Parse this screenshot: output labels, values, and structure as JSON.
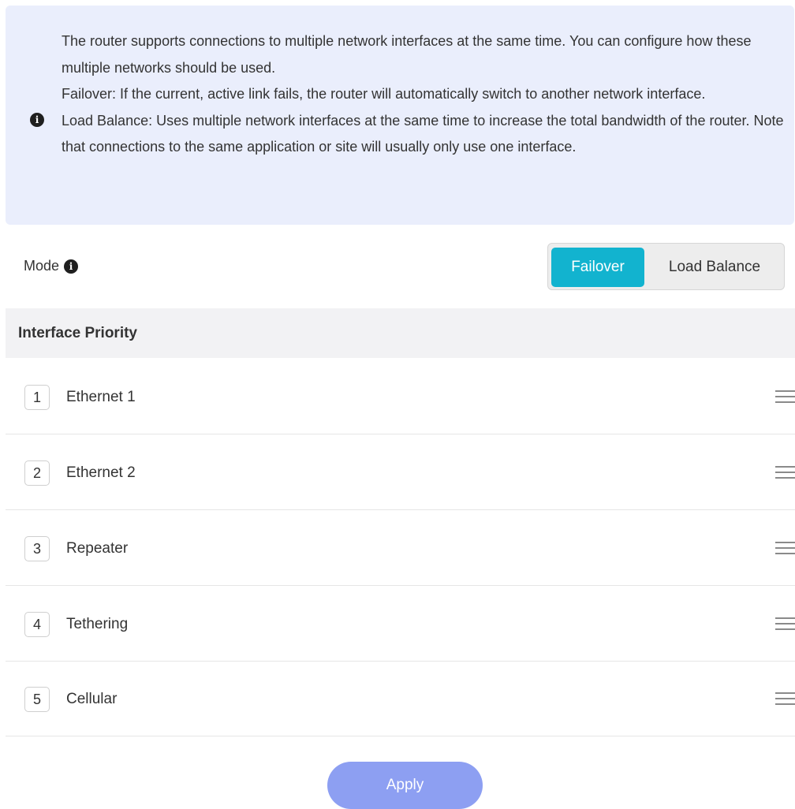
{
  "info": {
    "icon": "info-icon",
    "lines": [
      "The router supports connections to multiple network interfaces at the same time. You can configure how these multiple networks should be used.",
      "Failover: If the current, active link fails, the router will automatically switch to another network interface.",
      "Load Balance: Uses multiple network interfaces at the same time to increase the total bandwidth of the router. Note that connections to the same application or site will usually only use one interface."
    ]
  },
  "mode": {
    "label": "Mode",
    "options": [
      "Failover",
      "Load Balance"
    ],
    "selected": "Failover",
    "accent_color": "#12b3cf"
  },
  "priority": {
    "header": "Interface Priority",
    "items": [
      {
        "num": "1",
        "name": "Ethernet 1"
      },
      {
        "num": "2",
        "name": "Ethernet 2"
      },
      {
        "num": "3",
        "name": "Repeater"
      },
      {
        "num": "4",
        "name": "Tethering"
      },
      {
        "num": "5",
        "name": "Cellular"
      }
    ]
  },
  "apply": {
    "label": "Apply",
    "color": "#8d9ff2"
  }
}
